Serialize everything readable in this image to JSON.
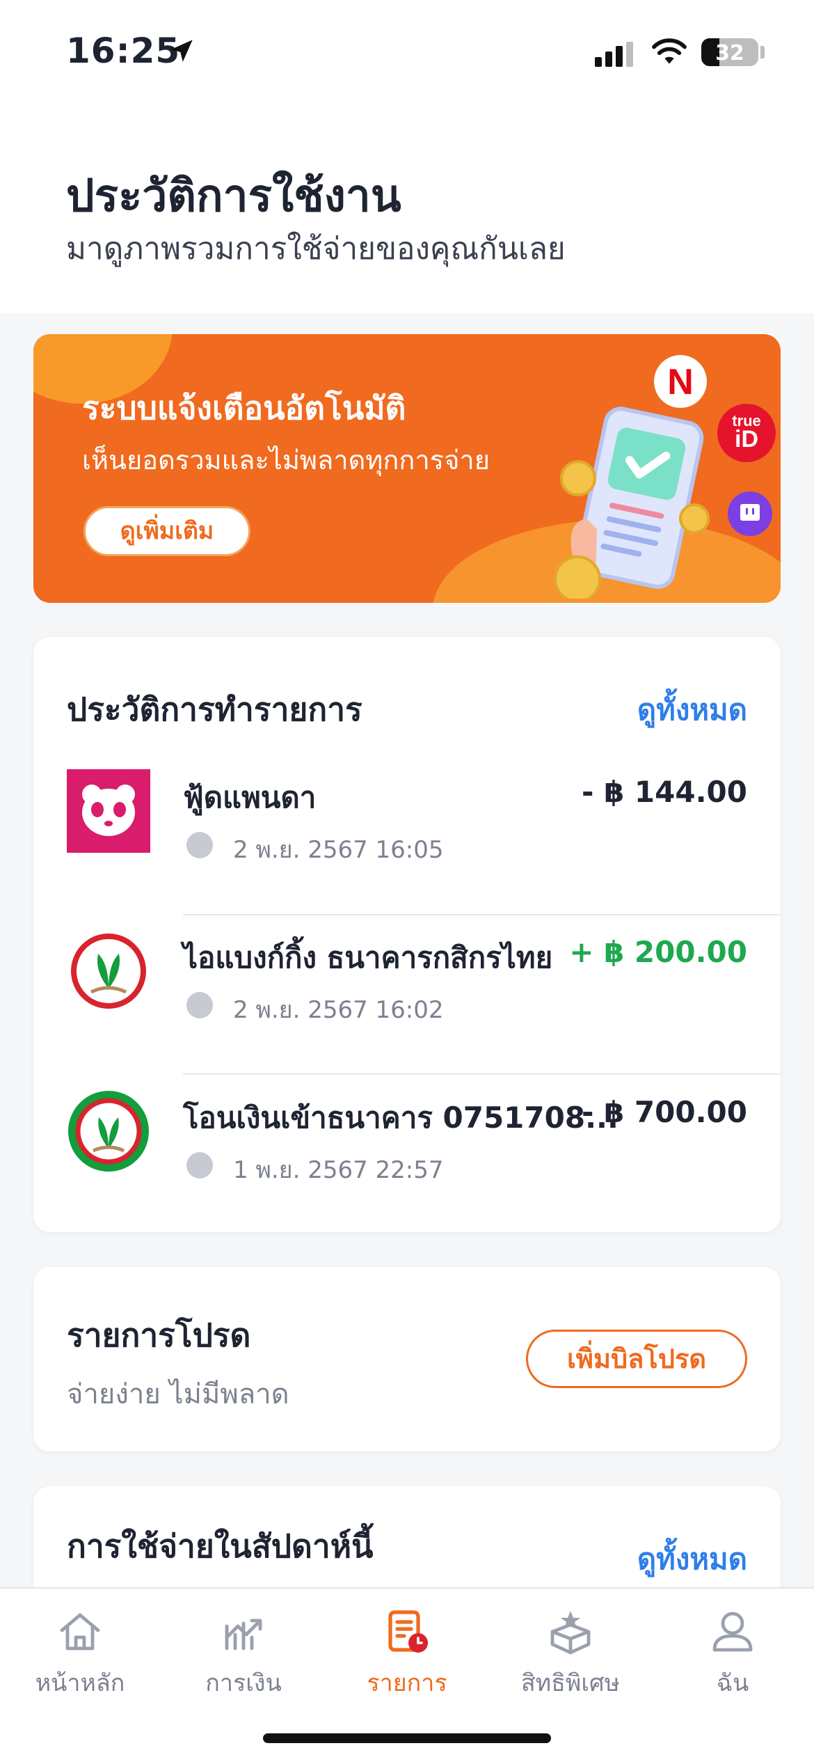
{
  "status_bar": {
    "time": "16:25",
    "battery": "32"
  },
  "header": {
    "title": "ประวัติการใช้งาน",
    "subtitle": "มาดูภาพรวมการใช้จ่ายของคุณกันเลย"
  },
  "banner": {
    "title": "ระบบแจ้งเตือนอัตโนมัติ",
    "subtitle": "เห็นยอดรวมและไม่พลาดทุกการจ่าย",
    "button_label": "ดูเพิ่มเติม",
    "brand_netflix": "N",
    "brand_trueid_top": "true",
    "brand_trueid_bottom": "iD"
  },
  "transactions": {
    "title": "ประวัติการทำรายการ",
    "view_all": "ดูทั้งหมด",
    "items": [
      {
        "name": "ฟู้ดแพนดา",
        "time": "2 พ.ย. 2567 16:05",
        "amount": "- ฿ 144.00",
        "color": "#1f2433"
      },
      {
        "name": "ไอแบงก์กิ้ง ธนาคารกสิกรไทย",
        "time": "2 พ.ย. 2567 16:02",
        "amount": "+ ฿ 200.00",
        "color": "#1ea84f"
      },
      {
        "name": "โอนเงินเข้าธนาคาร 0751708...",
        "time": "1 พ.ย. 2567 22:57",
        "amount": "- ฿ 700.00",
        "color": "#1f2433"
      }
    ]
  },
  "favorites": {
    "title": "รายการโปรด",
    "subtitle": "จ่ายง่าย ไม่มีพลาด",
    "button_label": "เพิ่มบิลโปรด"
  },
  "weekly": {
    "title": "การใช้จ่ายในสัปดาห์นี้",
    "view_all": "ดูทั้งหมด"
  },
  "nav": [
    {
      "label": "หน้าหลัก",
      "icon": "home-icon",
      "active": false
    },
    {
      "label": "การเงิน",
      "icon": "chart-icon",
      "active": false
    },
    {
      "label": "รายการ",
      "icon": "list-icon",
      "active": true
    },
    {
      "label": "สิทธิพิเศษ",
      "icon": "gift-icon",
      "active": false
    },
    {
      "label": "ฉัน",
      "icon": "profile-icon",
      "active": false
    }
  ],
  "colors": {
    "accent": "#ef6a1e",
    "link": "#2f7fe8",
    "positive": "#1ea84f",
    "banner": "#f06a1f"
  }
}
